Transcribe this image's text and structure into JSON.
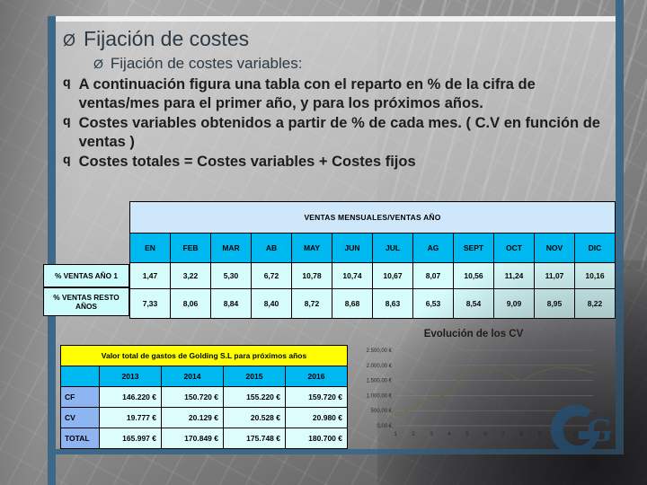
{
  "slide": {
    "heading": "Fijación de costes",
    "subheading": "Fijación de costes variables:",
    "bullets": [
      "A continuación figura una tabla con el reparto en % de la cifra de ventas/mes para el primer año, y para los próximos años.",
      "Costes variables obtenidos a partir de % de cada mes. ( C.V en función de ventas )",
      "Costes totales = Costes variables + Costes fijos"
    ],
    "bullet_glyph": "q",
    "arrow_glyph": "Ø"
  },
  "monthly_table": {
    "title": "VENTAS MENSUALES/VENTAS AÑO",
    "months": [
      "EN",
      "FEB",
      "MAR",
      "AB",
      "MAY",
      "JUN",
      "JUL",
      "AG",
      "SEPT",
      "OCT",
      "NOV",
      "DIC"
    ],
    "rows": [
      {
        "label": "% VENTAS AÑO 1",
        "values": [
          "1,47",
          "3,22",
          "5,30",
          "6,72",
          "10,78",
          "10,74",
          "10,67",
          "8,07",
          "10,56",
          "11,24",
          "11,07",
          "10,16"
        ]
      },
      {
        "label": "% VENTAS RESTO AÑOS",
        "values": [
          "7,33",
          "8,06",
          "8,84",
          "8,40",
          "8,72",
          "8,68",
          "8,63",
          "6,53",
          "8,54",
          "9,09",
          "8,95",
          "8,22"
        ]
      }
    ]
  },
  "totals_table": {
    "title": "Valor total de gastos de Golding S.L para próximos años",
    "years": [
      "2013",
      "2014",
      "2015",
      "2016"
    ],
    "rows": [
      {
        "label": "CF",
        "values": [
          "146.220 €",
          "150.720 €",
          "155.220 €",
          "159.720 €"
        ]
      },
      {
        "label": "CV",
        "values": [
          "19.777 €",
          "20.129 €",
          "20.528 €",
          "20.980 €"
        ]
      },
      {
        "label": "TOTAL",
        "values": [
          "165.997 €",
          "170.849 €",
          "175.748 €",
          "180.700 €"
        ]
      }
    ]
  },
  "chart_data": {
    "type": "line",
    "title": "Evolución de los CV",
    "xlabel": "",
    "ylabel": "",
    "x": [
      1,
      2,
      3,
      4,
      5,
      6,
      7,
      8,
      9,
      10,
      11,
      12
    ],
    "xticklabels": [
      "1",
      "2",
      "3",
      "4",
      "5",
      "6",
      "7",
      "8",
      "9",
      "10",
      "11",
      "12"
    ],
    "yticklabels": [
      "0,00 €",
      "500,00 €",
      "1.000,00 €",
      "1.500,00 €",
      "2.000,00 €",
      "2.500,00 €"
    ],
    "yticks": [
      0,
      500,
      1000,
      1500,
      2000,
      2500
    ],
    "ylim": [
      0,
      2500
    ],
    "grid": true,
    "legend": false,
    "series": [
      {
        "name": "CV",
        "color": "#7a7a55",
        "values": [
          330,
          640,
          880,
          1080,
          1860,
          1860,
          1830,
          1480,
          1790,
          1930,
          1900,
          1760
        ]
      }
    ]
  },
  "colors": {
    "accent_bar": "#3d6888",
    "month_header": "#00b8f0",
    "table_title": "#cfe7fb",
    "data_cell": "#d7fcfc",
    "totals_title": "#ffff00",
    "totals_label": "#8fb4f2",
    "chart_line": "#7a7a55"
  },
  "logo": {
    "name": "golding-logo",
    "letters": "G"
  }
}
